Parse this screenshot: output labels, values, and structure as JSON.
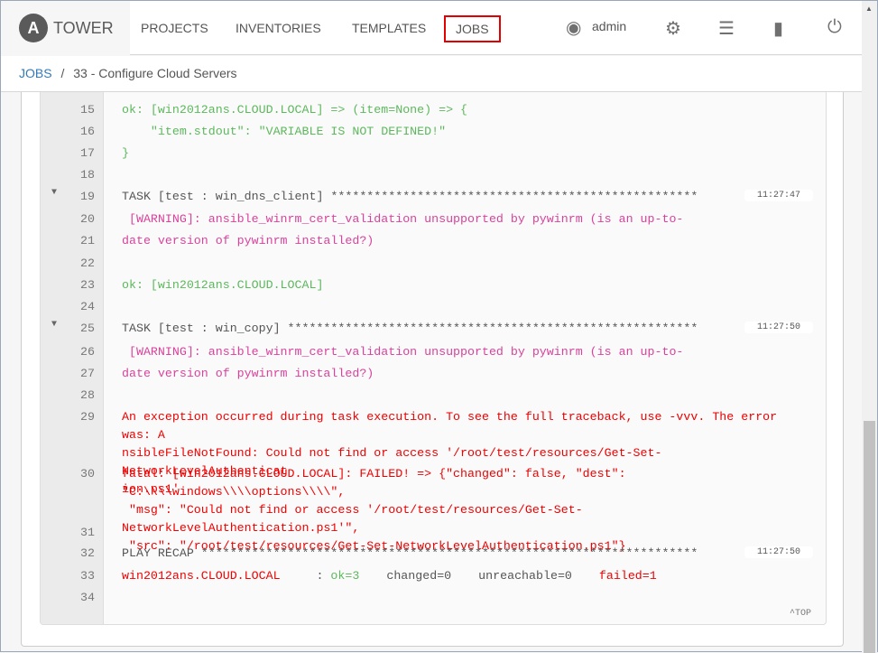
{
  "brand": "TOWER",
  "nav": [
    "PROJECTS",
    "INVENTORIES",
    "TEMPLATES",
    "JOBS"
  ],
  "user": "admin",
  "icons": [
    "user-icon",
    "gear-icon",
    "server-icon",
    "book-icon",
    "power-icon"
  ],
  "breadcrumb": {
    "root": "JOBS",
    "sep": "/",
    "current": "33 - Configure Cloud Servers"
  },
  "lines": [
    {
      "n": "15",
      "t": "ok: [win2012ans.CLOUD.LOCAL] => (item=None) => {",
      "c": "ok"
    },
    {
      "n": "16",
      "t": "    \"item.stdout\": \"VARIABLE IS NOT DEFINED!\"",
      "c": "ok"
    },
    {
      "n": "17",
      "t": "}",
      "c": "ok"
    },
    {
      "n": "18",
      "t": "",
      "c": "gray"
    },
    {
      "n": "19",
      "t": "TASK [test : win_dns_client] ***************************************************",
      "c": "gray",
      "ts": "11:27:47",
      "toggle": true
    },
    {
      "n": "20",
      "t": " [WARNING]: ansible_winrm_cert_validation unsupported by pywinrm (is an up-to-",
      "c": "warn"
    },
    {
      "n": "21",
      "t": "date version of pywinrm installed?)",
      "c": "warn"
    },
    {
      "n": "22",
      "t": "",
      "c": "gray"
    },
    {
      "n": "23",
      "t": "ok: [win2012ans.CLOUD.LOCAL]",
      "c": "ok"
    },
    {
      "n": "24",
      "t": "",
      "c": "gray"
    },
    {
      "n": "25",
      "t": "TASK [test : win_copy] *********************************************************",
      "c": "gray",
      "ts": "11:27:50",
      "toggle": true
    },
    {
      "n": "26",
      "t": " [WARNING]: ansible_winrm_cert_validation unsupported by pywinrm (is an up-to-",
      "c": "warn"
    },
    {
      "n": "27",
      "t": "date version of pywinrm installed?)",
      "c": "warn"
    },
    {
      "n": "28",
      "t": "",
      "c": "gray"
    },
    {
      "n": "29",
      "t": "An exception occurred during task execution. To see the full traceback, use -vvv. The error was: A\nnsibleFileNotFound: Could not find or access '/root/test/resources/Get-Set-NetworkLevelAuthenticat\nion.ps1'",
      "c": "err"
    },
    {
      "n": "30",
      "t": "fatal: [win2012ans.CLOUD.LOCAL]: FAILED! => {\"changed\": false, \"dest\": \"C:\\\\\\\\windows\\\\\\\\options\\\\\\\\\",\n \"msg\": \"Could not find or access '/root/test/resources/Get-Set-NetworkLevelAuthentication.ps1'\",\n \"src\": \"/root/test/resources/Get-Set-NetworkLevelAuthentication.ps1\"}",
      "c": "err"
    },
    {
      "n": "31",
      "t": "",
      "c": "gray"
    },
    {
      "n": "32",
      "t": "PLAY RECAP *********************************************************************",
      "c": "gray",
      "ts": "11:27:50"
    },
    {
      "n": "33",
      "recap": {
        "host": "win2012ans.CLOUD.LOCAL",
        "sep": "     : ",
        "ok": "ok=3",
        "changed": "changed=0",
        "unreachable": "unreachable=0",
        "failed": "failed=1"
      }
    },
    {
      "n": "34",
      "t": "",
      "c": "gray"
    }
  ],
  "top_link": "^TOP"
}
